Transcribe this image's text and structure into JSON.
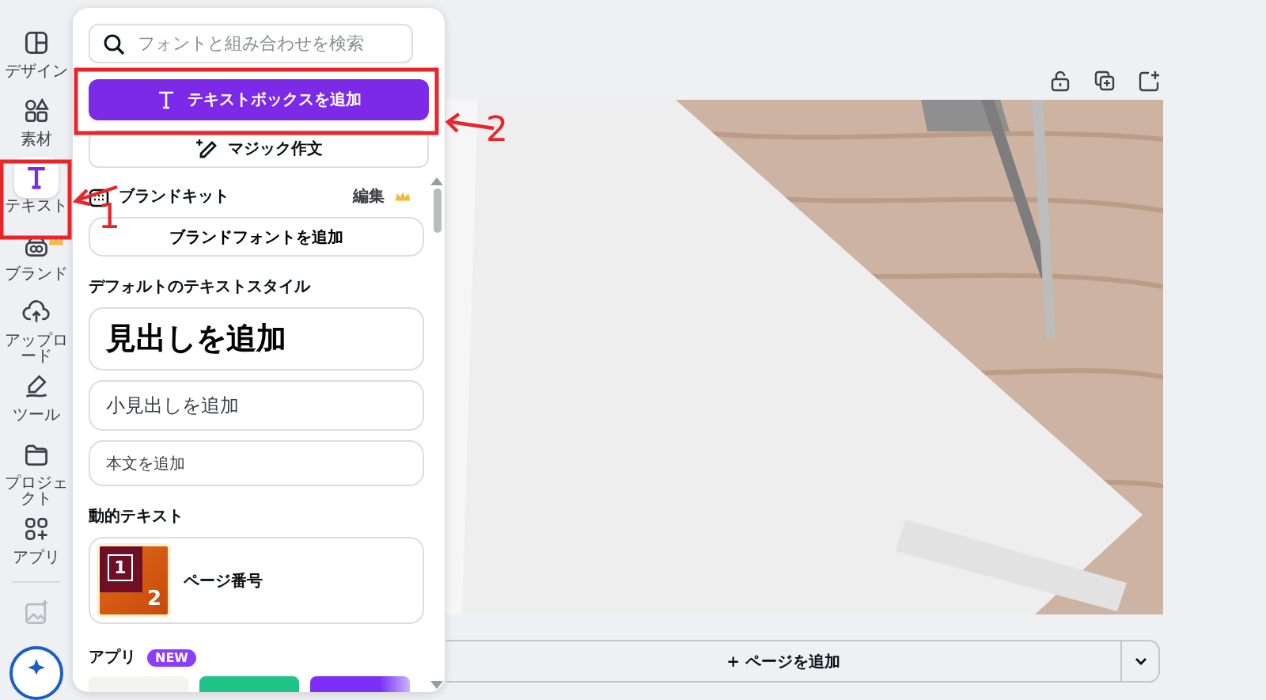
{
  "rail": {
    "items": [
      {
        "label": "デザイン",
        "selected": false,
        "premium": false
      },
      {
        "label": "素材",
        "selected": false,
        "premium": false
      },
      {
        "label": "テキスト",
        "selected": true,
        "premium": false
      },
      {
        "label": "ブランド",
        "selected": false,
        "premium": true
      },
      {
        "label": "アップロード",
        "selected": false,
        "premium": false
      },
      {
        "label": "ツール",
        "selected": false,
        "premium": false
      },
      {
        "label": "プロジェクト",
        "selected": false,
        "premium": false
      },
      {
        "label": "アプリ",
        "selected": false,
        "premium": false
      }
    ]
  },
  "panel": {
    "search": {
      "placeholder": "フォントと組み合わせを検索"
    },
    "add_textbox_button": "テキストボックスを追加",
    "magic_write_button": "マジック作文",
    "brand_kit": {
      "title": "ブランドキット",
      "edit": "編集",
      "premium": true
    },
    "brand_font_button": "ブランドフォントを追加",
    "default_styles": {
      "title": "デフォルトのテキストスタイル",
      "heading": "見出しを追加",
      "subheading": "小見出しを追加",
      "body": "本文を追加"
    },
    "dynamic_text": {
      "title": "動的テキスト",
      "items": [
        {
          "label": "ページ番号",
          "thumbnail_digits": [
            "1",
            "2"
          ]
        }
      ]
    },
    "apps": {
      "title": "アプリ",
      "badge": "NEW"
    }
  },
  "stage": {
    "add_page_button": "+ ページを追加"
  },
  "annotations": [
    {
      "number": "1"
    },
    {
      "number": "2"
    }
  ]
}
